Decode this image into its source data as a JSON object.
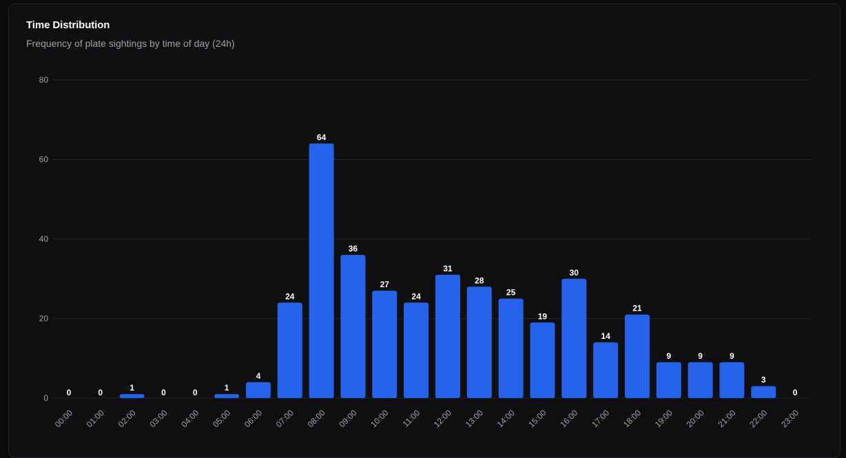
{
  "card": {
    "title": "Time Distribution",
    "subtitle": "Frequency of plate sightings by time of day (24h)"
  },
  "colors": {
    "bar": "#2563eb",
    "background": "#0f0f11",
    "grid": "#26262b",
    "tick_text": "#a1a1aa",
    "label_text": "#ffffff"
  },
  "chart_data": {
    "type": "bar",
    "categories": [
      "00:00",
      "01:00",
      "02:00",
      "03:00",
      "04:00",
      "05:00",
      "06:00",
      "07:00",
      "08:00",
      "09:00",
      "10:00",
      "11:00",
      "12:00",
      "13:00",
      "14:00",
      "15:00",
      "16:00",
      "17:00",
      "18:00",
      "19:00",
      "20:00",
      "21:00",
      "22:00",
      "23:00"
    ],
    "values": [
      0,
      0,
      1,
      0,
      0,
      1,
      4,
      24,
      64,
      36,
      27,
      24,
      31,
      28,
      25,
      19,
      30,
      14,
      21,
      9,
      9,
      9,
      3,
      0
    ],
    "ylim": [
      0,
      80
    ],
    "yticks": [
      0,
      20,
      40,
      60,
      80
    ],
    "grid": true,
    "data_labels": true,
    "x_tick_rotation": "diagonal"
  }
}
